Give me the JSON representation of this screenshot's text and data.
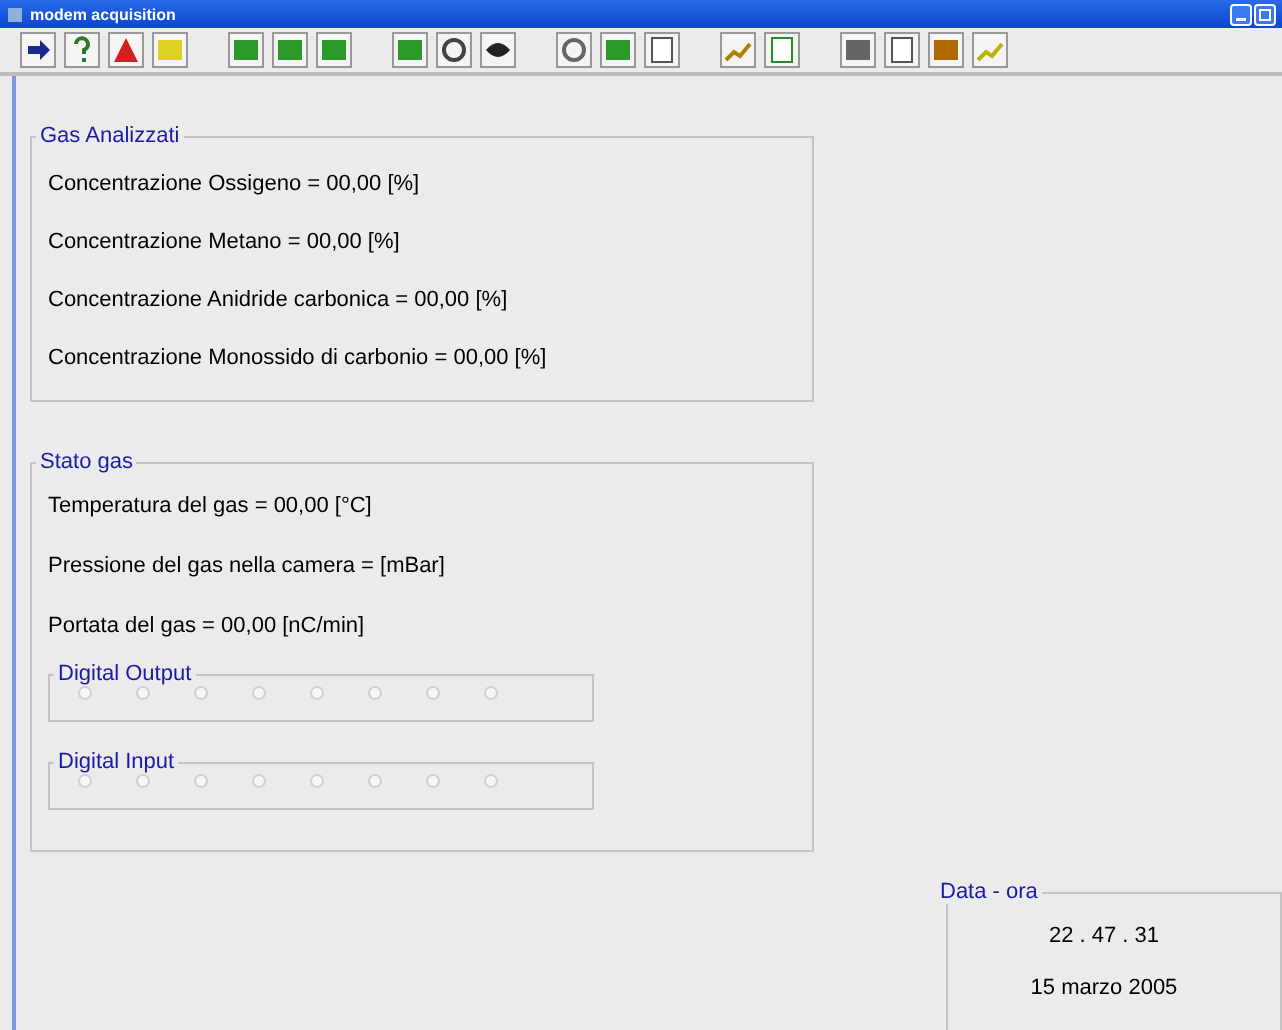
{
  "window": {
    "title": "modem acquisition"
  },
  "gas_analizzati": {
    "title": "Gas Analizzati",
    "lines": [
      "Concentrazione Ossigeno = 00,00 [%]",
      "Concentrazione Metano = 00,00 [%]",
      "Concentrazione Anidride carbonica = 00,00 [%]",
      "Concentrazione Monossido di carbonio = 00,00 [%]"
    ]
  },
  "stato_gas": {
    "title": "Stato gas",
    "lines": [
      "Temperatura del gas = 00,00 [°C]",
      "Pressione del gas nella camera =  [mBar]",
      "Portata del gas = 00,00 [nC/min]"
    ],
    "digital_output": {
      "title": "Digital Output",
      "leds": [
        {
          "on": false
        },
        {
          "on": false
        },
        {
          "on": false
        },
        {
          "on": false
        },
        {
          "on": false
        },
        {
          "on": false
        },
        {
          "on": false
        },
        {
          "on": false
        }
      ]
    },
    "digital_input": {
      "title": "Digital Input",
      "leds": [
        {
          "on": false
        },
        {
          "on": false
        },
        {
          "on": false
        },
        {
          "on": false
        },
        {
          "on": false
        },
        {
          "on": false
        },
        {
          "on": false
        },
        {
          "on": false
        }
      ]
    }
  },
  "data_ora": {
    "title": "Data - ora",
    "time": "22 . 47 . 31",
    "date": "15 marzo 2005"
  }
}
